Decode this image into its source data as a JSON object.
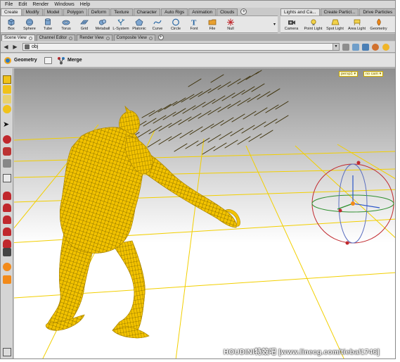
{
  "menu": [
    "File",
    "Edit",
    "Render",
    "Windows",
    "Help"
  ],
  "shelf_tabs_left": [
    "Create",
    "Modify",
    "Model",
    "Polygon",
    "Deform",
    "Texture",
    "Character",
    "Auto Rigs",
    "Animation",
    "Clouds"
  ],
  "shelf_tabs_right": [
    "Lights and Ca...",
    "Create Particl...",
    "Drive Particles"
  ],
  "tools_left": [
    {
      "label": "Box",
      "icon": "box-icon"
    },
    {
      "label": "Sphere",
      "icon": "sphere-icon"
    },
    {
      "label": "Tube",
      "icon": "tube-icon"
    },
    {
      "label": "Torus",
      "icon": "torus-icon"
    },
    {
      "label": "Grid",
      "icon": "grid-icon"
    },
    {
      "label": "Metaball",
      "icon": "metaball-icon"
    },
    {
      "label": "L-System",
      "icon": "lsystem-icon"
    },
    {
      "label": "Platonic",
      "icon": "platonic-icon"
    },
    {
      "label": "Curve",
      "icon": "curve-icon"
    },
    {
      "label": "Circle",
      "icon": "circle-icon"
    },
    {
      "label": "Font",
      "icon": "font-icon"
    },
    {
      "label": "File",
      "icon": "file-icon"
    },
    {
      "label": "Null",
      "icon": "null-icon"
    }
  ],
  "tools_right": [
    {
      "label": "Camera",
      "icon": "camera-icon"
    },
    {
      "label": "Point Light",
      "icon": "point-light-icon"
    },
    {
      "label": "Spot Light",
      "icon": "spot-light-icon"
    },
    {
      "label": "Area Light",
      "icon": "area-light-icon"
    },
    {
      "label": "Geometry",
      "icon": "geometry-light-icon"
    }
  ],
  "pane_tabs": [
    "Scene View",
    "Channel Editor",
    "Render View",
    "Composite View"
  ],
  "path": {
    "value": "obj"
  },
  "operator": {
    "context": "Geometry",
    "node": "Merge"
  },
  "viewport": {
    "camera_menu": "persp1 ▾",
    "cam_menu": "no cam ▾"
  },
  "watermark": "HOUDINI特效吧  [www.linecg.com/tieba/1746]",
  "colors": {
    "accent": "#f0c800",
    "wireframe": "#f2c200",
    "grid": "#f5d400"
  }
}
